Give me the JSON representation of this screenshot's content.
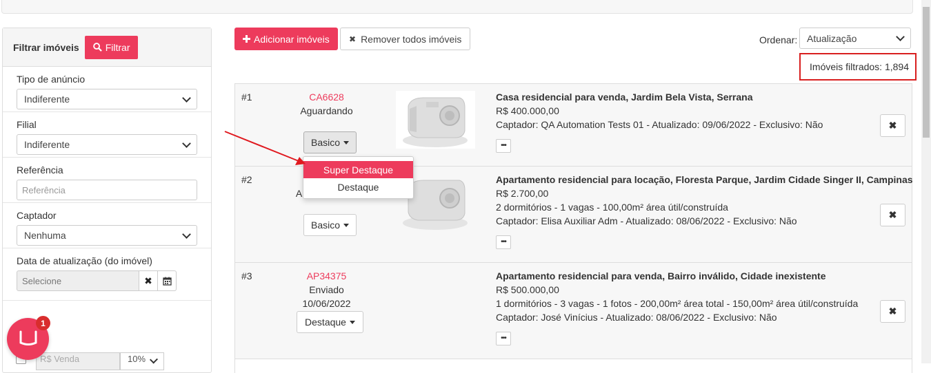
{
  "sidebar": {
    "title": "Filtrar imóveis",
    "filter_button": "Filtrar",
    "tipo_label": "Tipo de anúncio",
    "tipo_value": "Indiferente",
    "filial_label": "Filial",
    "filial_value": "Indiferente",
    "referencia_label": "Referência",
    "referencia_placeholder": "Referência",
    "captador_label": "Captador",
    "captador_value": "Nenhuma",
    "data_label": "Data de atualização (do imóvel)",
    "data_placeholder": "Selecione",
    "valor_placeholder": "R$ Venda",
    "percent_value": "10%"
  },
  "toolbar": {
    "add_label": "Adicionar imóveis",
    "remove_label": "Remover todos imóveis",
    "order_label": "Ordenar:",
    "order_value": "Atualização",
    "count_text": "Imóveis filtrados: 1,894"
  },
  "rows": [
    {
      "num": "#1",
      "code": "CA6628",
      "status": "Aguardando",
      "plan": "Basico",
      "title": "Casa residencial para venda, Jardim Bela Vista, Serrana",
      "price": "R$ 400.000,00",
      "line3": "Captador: QA Automation Tests 01 - Atualizado: 09/06/2022 - Exclusivo: Não"
    },
    {
      "num": "#2",
      "code": "",
      "status": "A",
      "plan": "Basico",
      "title": "Apartamento residencial para locação, Floresta Parque, Jardim Cidade Singer II, Campinas",
      "price": "R$ 2.700,00",
      "line3": "2 dormitórios - 1 vagas - 100,00m² área útil/construída",
      "line4": "Captador: Elisa Auxiliar Adm - Atualizado: 08/06/2022 - Exclusivo: Não"
    },
    {
      "num": "#3",
      "code": "AP34375",
      "status": "Enviado",
      "date": "10/06/2022",
      "plan": "Destaque",
      "title": "Apartamento residencial para venda, Bairro inválido, Cidade inexistente",
      "price": "R$ 500.000,00",
      "line3": "1 dormitórios - 3 vagas - 1 fotos - 200,00m² área total - 150,00m² área útil/construída",
      "line4": "Captador: José Vinícius - Atualizado: 08/06/2022 - Exclusivo: Não"
    }
  ],
  "dropdown": {
    "items": [
      "Super Destaque",
      "Destaque"
    ]
  },
  "chat": {
    "badge": "1"
  },
  "colors": {
    "accent": "#ed3b5c",
    "highlight_box": "#d81e1e"
  }
}
